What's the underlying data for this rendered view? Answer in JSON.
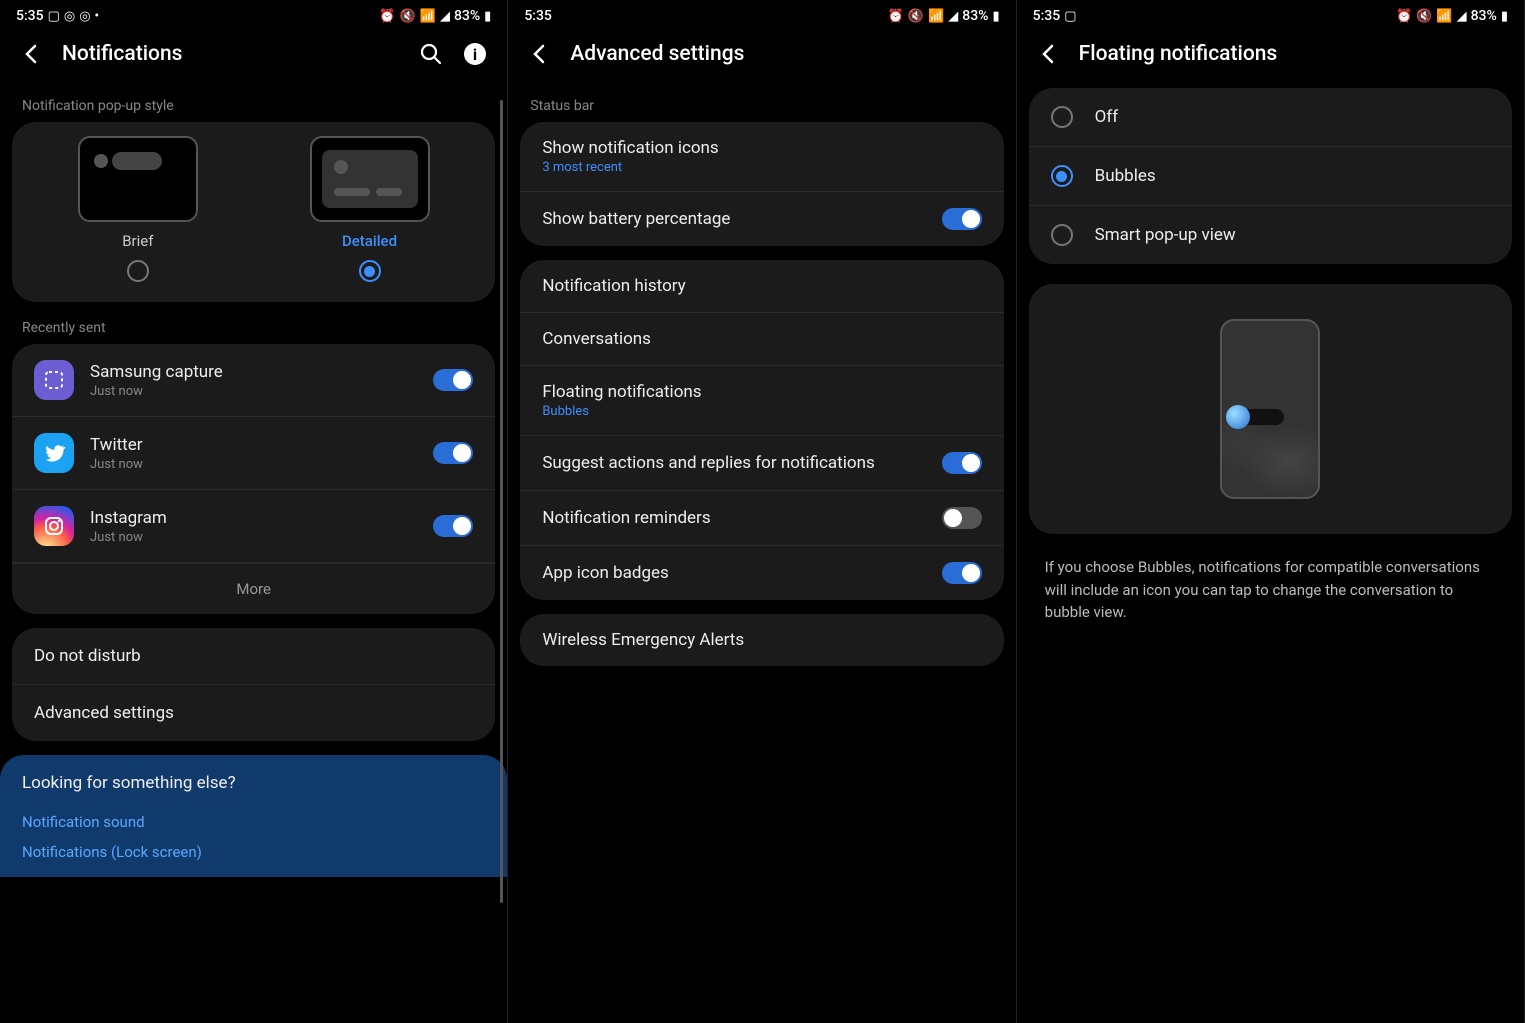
{
  "status": {
    "time": "5:35",
    "battery": "83%"
  },
  "phone1": {
    "title": "Notifications",
    "sections": {
      "popup_label": "Notification pop-up style",
      "popup_options": [
        {
          "label": "Brief",
          "selected": false
        },
        {
          "label": "Detailed",
          "selected": true
        }
      ],
      "recent_label": "Recently sent",
      "recent_apps": [
        {
          "name": "Samsung capture",
          "sub": "Just now",
          "iconClass": "purple",
          "toggle": true
        },
        {
          "name": "Twitter",
          "sub": "Just now",
          "iconClass": "twitter",
          "toggle": true
        },
        {
          "name": "Instagram",
          "sub": "Just now",
          "iconClass": "instagram",
          "toggle": true
        }
      ],
      "more": "More",
      "extra_rows": [
        "Do not disturb",
        "Advanced settings"
      ],
      "lookfor_title": "Looking for something else?",
      "lookfor_links": [
        "Notification sound",
        "Notifications (Lock screen)"
      ]
    }
  },
  "phone2": {
    "title": "Advanced settings",
    "section_label": "Status bar",
    "group1": [
      {
        "title": "Show notification icons",
        "sub": "3 most recent",
        "subAccent": true
      },
      {
        "title": "Show battery percentage",
        "toggle": true
      }
    ],
    "group2": [
      {
        "title": "Notification history"
      },
      {
        "title": "Conversations"
      },
      {
        "title": "Floating notifications",
        "sub": "Bubbles",
        "subAccent": true
      },
      {
        "title": "Suggest actions and replies for notifications",
        "toggle": true
      },
      {
        "title": "Notification reminders",
        "toggle": false
      },
      {
        "title": "App icon badges",
        "toggle": true
      }
    ],
    "group3": [
      {
        "title": "Wireless Emergency Alerts"
      }
    ]
  },
  "phone3": {
    "title": "Floating notifications",
    "options": [
      {
        "label": "Off",
        "selected": false
      },
      {
        "label": "Bubbles",
        "selected": true
      },
      {
        "label": "Smart pop-up view",
        "selected": false
      }
    ],
    "desc": "If you choose Bubbles, notifications for compatible conversations will include an icon you can tap to change the conversation to bubble view."
  }
}
